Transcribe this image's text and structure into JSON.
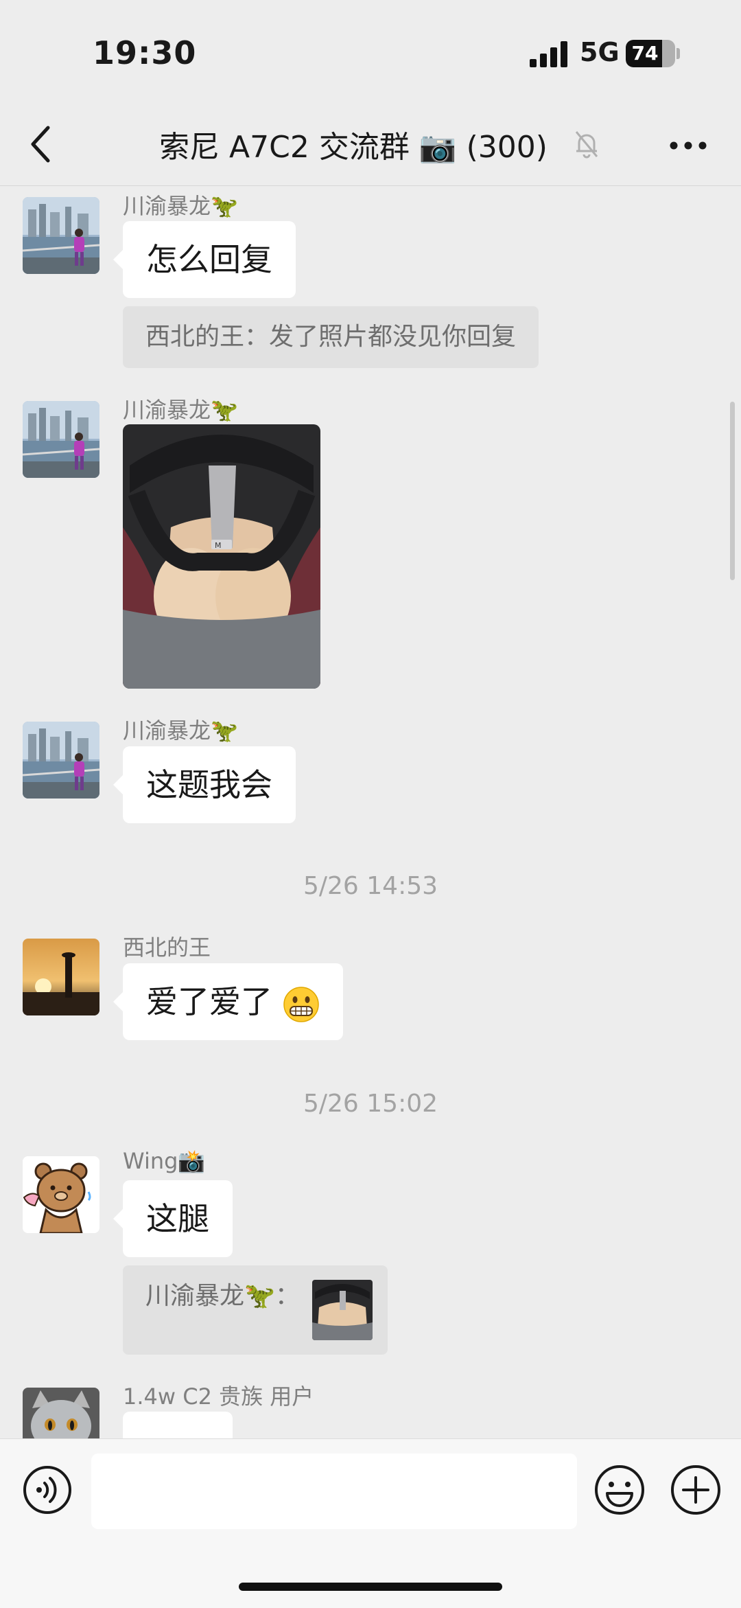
{
  "status_bar": {
    "time": "19:30",
    "network": "5G",
    "battery": "74",
    "battery_fraction": 0.74
  },
  "header": {
    "back_icon": "chevron-left-icon",
    "title": "索尼 A7C2 交流群 📷 (300)",
    "mute_icon": "bell-slash-icon",
    "more_icon": "ellipsis-icon"
  },
  "messages": [
    {
      "sender": "川渝暴龙🦖",
      "text": "怎么回复",
      "quote": "西北的王：发了照片都没见你回复"
    },
    {
      "sender": "川渝暴龙🦖",
      "image": "steering-wheel-photo"
    },
    {
      "sender": "川渝暴龙🦖",
      "text": "这题我会"
    },
    {
      "timestamp": "5/26 14:53"
    },
    {
      "sender": "西北的王",
      "text": "爱了爱了",
      "emoji": "grin-emoji"
    },
    {
      "timestamp": "5/26 15:02"
    },
    {
      "sender": "Wing📸",
      "text": "这腿",
      "quote": "川渝暴龙🦖："
    },
    {
      "sender": "1.4w C2 贵族 用户"
    }
  ],
  "input_bar": {
    "voice_icon": "voice-icon",
    "emoji_icon": "emoji-icon",
    "plus_icon": "plus-circle-icon",
    "placeholder": ""
  },
  "colors": {
    "background": "#ededed",
    "bubble": "#ffffff",
    "quote": "#e1e1e1",
    "sender": "#7f7f7f",
    "timestamp": "#a3a3a3"
  }
}
